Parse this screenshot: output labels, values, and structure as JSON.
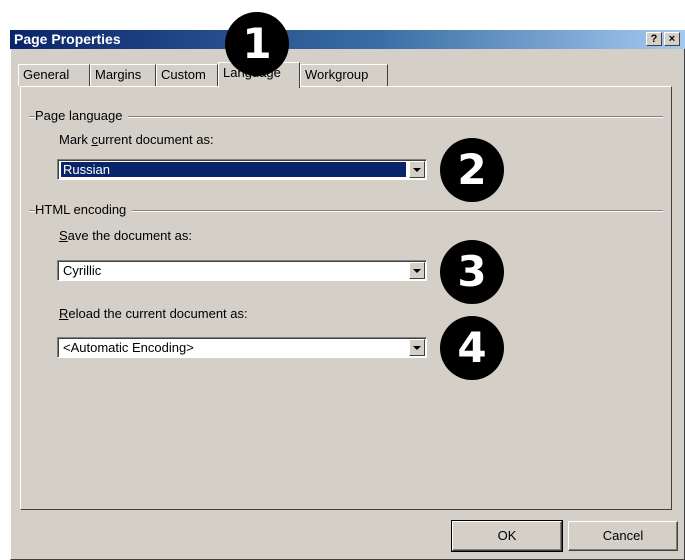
{
  "window": {
    "title": "Page Properties",
    "help_button": "?",
    "close_button": "×"
  },
  "tabs": [
    {
      "label": "General",
      "active": false
    },
    {
      "label": "Margins",
      "active": false
    },
    {
      "label": "Custom",
      "active": false
    },
    {
      "label": "Language",
      "active": true
    },
    {
      "label": "Workgroup",
      "active": false
    }
  ],
  "page_language": {
    "group_label": "Page language",
    "mark_label_pre": "Mark ",
    "mark_label_u": "c",
    "mark_label_post": "urrent document as:",
    "mark_value": "Russian"
  },
  "html_encoding": {
    "group_label": "HTML encoding",
    "save_label_u": "S",
    "save_label_post": "ave the document as:",
    "save_value": "Cyrillic",
    "reload_label_u": "R",
    "reload_label_post": "eload the current document as:",
    "reload_value": "<Automatic Encoding>"
  },
  "buttons": {
    "ok": "OK",
    "cancel": "Cancel"
  },
  "callouts": [
    "1",
    "2",
    "3",
    "4"
  ]
}
